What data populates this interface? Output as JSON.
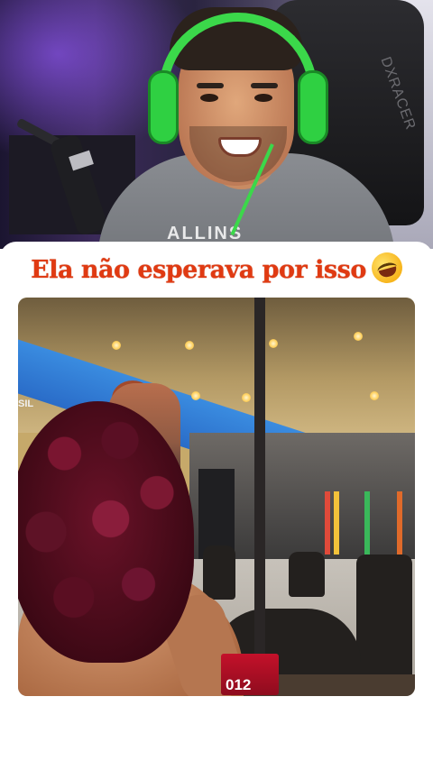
{
  "caption": {
    "text": "Ela não esperava por isso",
    "emoji": "rolling-on-the-floor-laughing-emoji",
    "color": "#e03a12"
  },
  "webcam": {
    "shirt_text": "ALLINS",
    "chair_brand": "DXRACER"
  },
  "video": {
    "menu_number": "012",
    "sign_text": "SIL"
  }
}
